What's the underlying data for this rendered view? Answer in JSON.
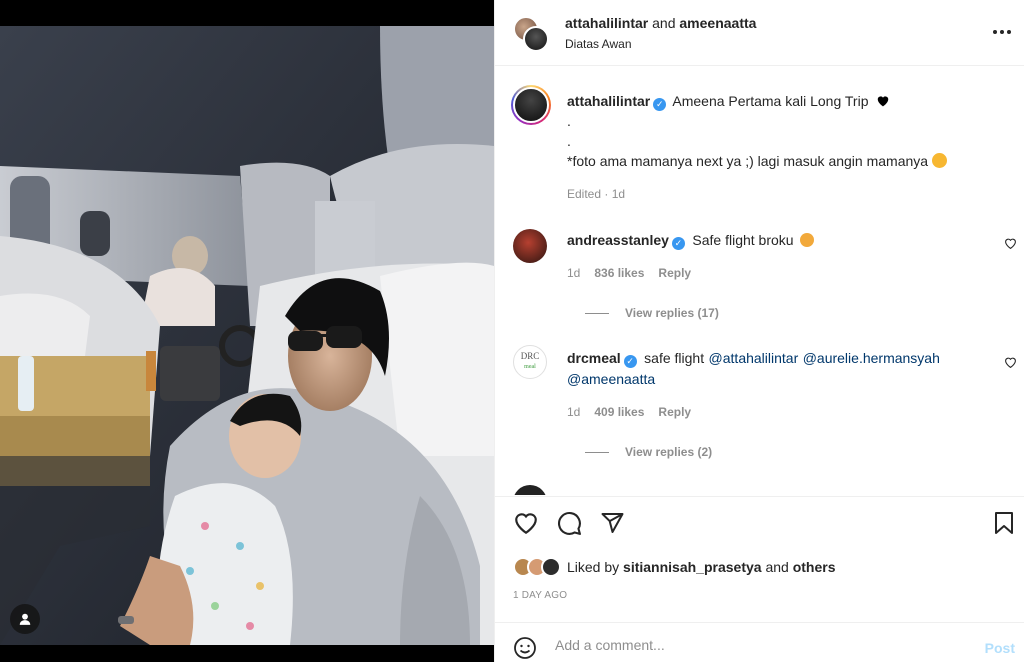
{
  "header": {
    "user1": "attahalilintar",
    "conjunction": "and",
    "user2": "ameenaatta",
    "location": "Diatas Awan"
  },
  "caption": {
    "username": "attahalilintar",
    "line1": "Ameena Pertama kali Long Trip",
    "line2": ".",
    "line3": ".",
    "line4": "*foto ama mamanya next ya ;) lagi masuk angin mamanya",
    "meta": "Edited · 1d"
  },
  "comments": [
    {
      "username": "andreasstanley",
      "text": "Safe flight broku",
      "time": "1d",
      "likes": "836 likes",
      "reply": "Reply",
      "view_replies": "View replies (17)"
    },
    {
      "username": "drcmeal",
      "text": "safe flight",
      "mentions": [
        "@attahalilintar",
        "@aurelie.hermansyah",
        "@ameenaatta"
      ],
      "time": "1d",
      "likes": "409 likes",
      "reply": "Reply",
      "view_replies": "View replies (2)"
    }
  ],
  "liked_by": {
    "prefix": "Liked by",
    "user": "sitiannisah_prasetya",
    "and": "and",
    "others": "others"
  },
  "timestamp": "1 DAY AGO",
  "add_comment": {
    "placeholder": "Add a comment...",
    "post_label": "Post"
  },
  "icons": {
    "like": "heart-icon",
    "comment": "comment-icon",
    "share": "share-icon",
    "save": "bookmark-icon",
    "more": "more-icon",
    "emoji": "emoji-icon",
    "tag": "tag-user-icon"
  },
  "colors": {
    "verified": "#3897f0",
    "mention": "#00376b",
    "muted": "#8e8e8e",
    "post_disabled": "#b2dffc"
  }
}
